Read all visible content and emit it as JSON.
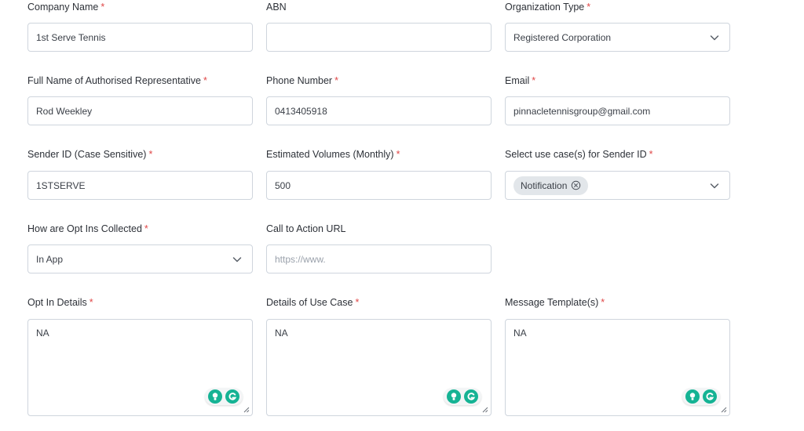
{
  "company_name": {
    "label": "Company Name",
    "required": "*",
    "value": "1st Serve Tennis"
  },
  "abn": {
    "label": "ABN",
    "value": ""
  },
  "organization_type": {
    "label": "Organization Type",
    "required": "*",
    "value": "Registered Corporation"
  },
  "authorised_rep": {
    "label": "Full Name of Authorised Representative",
    "required": "*",
    "value": "Rod Weekley"
  },
  "phone": {
    "label": "Phone Number",
    "required": "*",
    "value": "0413405918"
  },
  "email": {
    "label": "Email",
    "required": "*",
    "value": "pinnacletennisgroup@gmail.com"
  },
  "sender_id": {
    "label": "Sender ID (Case Sensitive)",
    "required": "*",
    "value": "1STSERVE"
  },
  "volumes": {
    "label": "Estimated Volumes (Monthly)",
    "required": "*",
    "value": "500"
  },
  "use_cases": {
    "label": "Select use case(s) for Sender ID",
    "required": "*",
    "chips": [
      "Notification"
    ]
  },
  "opt_ins": {
    "label": "How are Opt Ins Collected",
    "required": "*",
    "value": "In App"
  },
  "cta_url": {
    "label": "Call to Action URL",
    "value": "",
    "placeholder": "https://www."
  },
  "opt_in_details": {
    "label": "Opt In Details",
    "required": "*",
    "value": "NA"
  },
  "use_case_details": {
    "label": "Details of Use Case",
    "required": "*",
    "value": "NA"
  },
  "message_templates": {
    "label": "Message Template(s)",
    "required": "*",
    "value": "NA"
  },
  "colors": {
    "required": "#e04848",
    "border": "#cfd5dd",
    "chip_bg": "#e2e6ea",
    "grammarly": "#15b394"
  },
  "icons": [
    "chevron-down-icon",
    "chip-remove-icon",
    "grammarly-suggestion-icon",
    "grammarly-logo-icon",
    "resize-handle-icon"
  ]
}
